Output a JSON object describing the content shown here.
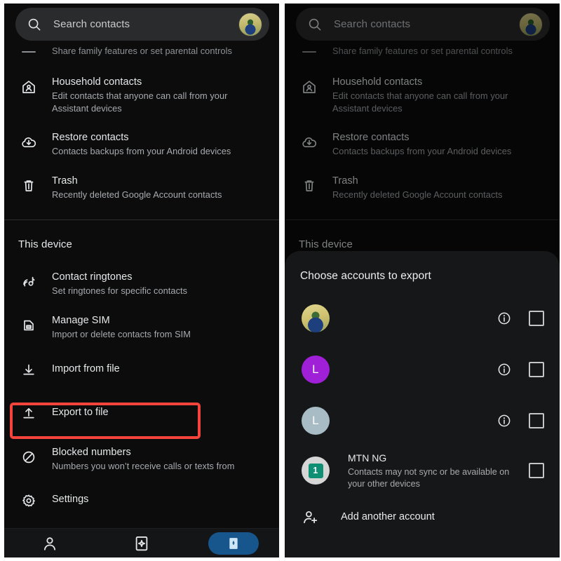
{
  "app": {
    "title": "Google Contacts settings"
  },
  "search": {
    "placeholder": "Search contacts",
    "icon": "search-icon"
  },
  "left_panel": {
    "clipped_row": {
      "sub": "Share family features or set parental controls"
    },
    "google_items": [
      {
        "icon": "household-icon",
        "title": "Household contacts",
        "sub": "Edit contacts that anyone can call from your Assistant devices"
      },
      {
        "icon": "restore-cloud-icon",
        "title": "Restore contacts",
        "sub": "Contacts backups from your Android devices"
      },
      {
        "icon": "trash-icon",
        "title": "Trash",
        "sub": "Recently deleted Google Account contacts"
      }
    ],
    "section_label": "This device",
    "device_items": [
      {
        "icon": "ringtone-icon",
        "title": "Contact ringtones",
        "sub": "Set ringtones for specific contacts"
      },
      {
        "icon": "sim-card-icon",
        "title": "Manage SIM",
        "sub": "Import or delete contacts from SIM"
      },
      {
        "icon": "import-icon",
        "title": "Import from file",
        "sub": ""
      },
      {
        "icon": "export-icon",
        "title": "Export to file",
        "sub": ""
      },
      {
        "icon": "block-icon",
        "title": "Blocked numbers",
        "sub": "Numbers you won’t receive calls or texts from"
      },
      {
        "icon": "gear-icon",
        "title": "Settings",
        "sub": ""
      }
    ]
  },
  "bottom_nav": [
    {
      "icon": "contacts-person-icon",
      "selected": false
    },
    {
      "icon": "highlights-sparkle-icon",
      "selected": false
    },
    {
      "icon": "organize-bookmark-icon",
      "selected": true
    }
  ],
  "dialog": {
    "title": "Choose accounts to export",
    "accounts": [
      {
        "avatar": "photo-avatar",
        "initial": "",
        "name": "",
        "sub": "",
        "redacted": true,
        "info": true,
        "checked": false
      },
      {
        "avatar": "purple-avatar",
        "initial": "L",
        "name": "",
        "sub": "",
        "redacted": true,
        "info": true,
        "checked": false
      },
      {
        "avatar": "steel-avatar",
        "initial": "L",
        "name": "",
        "sub": "",
        "redacted": true,
        "info": true,
        "checked": false
      },
      {
        "avatar": "sim-avatar",
        "initial": "1",
        "name": "MTN NG",
        "sub": "Contacts may not sync or be available on your other devices",
        "redacted": false,
        "info": false,
        "checked": false
      }
    ],
    "add_account": {
      "icon": "person-add-icon",
      "label": "Add another account"
    }
  },
  "annotations": {
    "color": "#f4443c",
    "boxes": [
      {
        "name": "export-to-file-highlight",
        "target": "Export to file"
      },
      {
        "name": "account-checkbox-highlight",
        "target": "second account checkbox"
      }
    ]
  }
}
